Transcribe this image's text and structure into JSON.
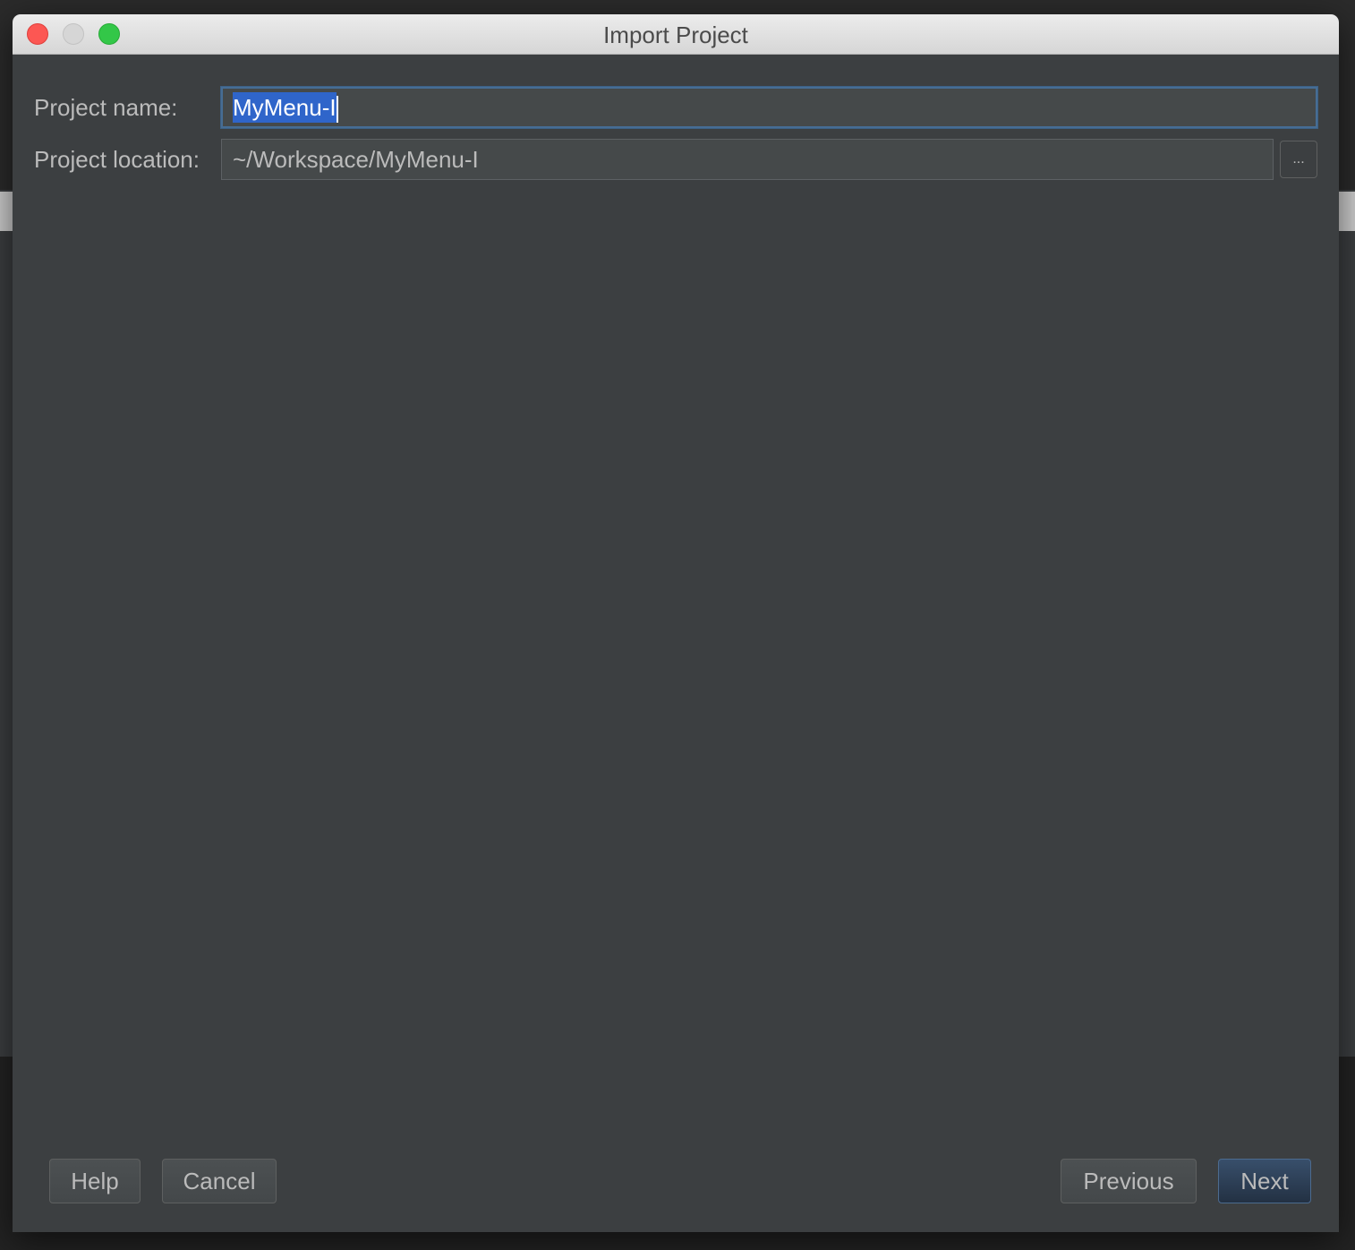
{
  "window": {
    "title": "Import Project"
  },
  "form": {
    "project_name_label": "Project name:",
    "project_name_value": "MyMenu-I",
    "project_location_label": "Project location:",
    "project_location_value": "~/Workspace/MyMenu-I",
    "browse_label": "..."
  },
  "buttons": {
    "help": "Help",
    "cancel": "Cancel",
    "previous": "Previous",
    "next": "Next"
  },
  "colors": {
    "background": "#3c3f41",
    "field_background": "#45494a",
    "focus_border": "#466d94",
    "selection": "#2f65ca",
    "default_button": "#2b3d54"
  }
}
